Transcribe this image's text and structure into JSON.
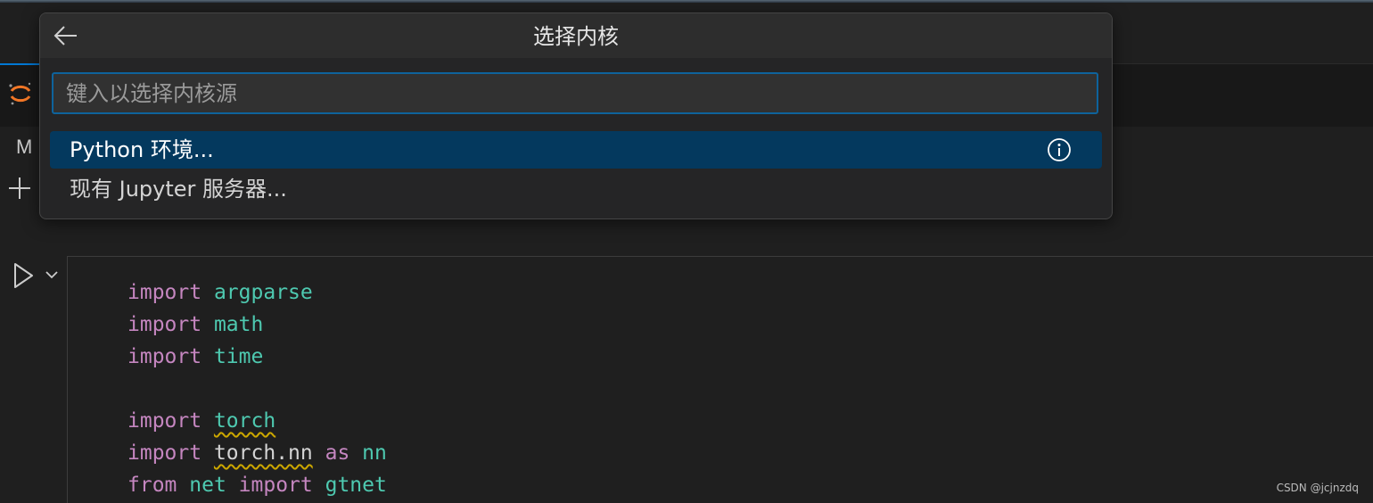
{
  "quick_pick": {
    "title": "选择内核",
    "input_placeholder": "键入以选择内核源",
    "input_value": "",
    "items": [
      {
        "label": "Python 环境...",
        "selected": true
      },
      {
        "label": "现有 Jupyter 服务器...",
        "selected": false
      }
    ]
  },
  "notebook": {
    "toolbar_label": "M",
    "cell_code": {
      "line1": {
        "kw": "import",
        "mod": "argparse"
      },
      "line2": {
        "kw": "import",
        "mod": "math"
      },
      "line3": {
        "kw": "import",
        "mod": "time"
      },
      "line4": {
        "kw": "import",
        "mod": "torch"
      },
      "line5": {
        "kw": "import",
        "mod": "torch.nn",
        "kw2": "as",
        "alias": "nn"
      },
      "line6": {
        "kw": "from",
        "mod": "net",
        "kw2": "import",
        "alias": "gtnet"
      }
    }
  },
  "watermark": "CSDN @jcjnzdq",
  "colors": {
    "accent": "#0078d4",
    "selection": "#04395e",
    "keyword": "#c586c0",
    "module": "#4ec9b0",
    "jupyter_orange": "#f37726"
  },
  "icons": [
    "back-arrow-icon",
    "info-icon",
    "jupyter-icon",
    "plus-icon",
    "run-icon",
    "chevron-down-icon"
  ]
}
